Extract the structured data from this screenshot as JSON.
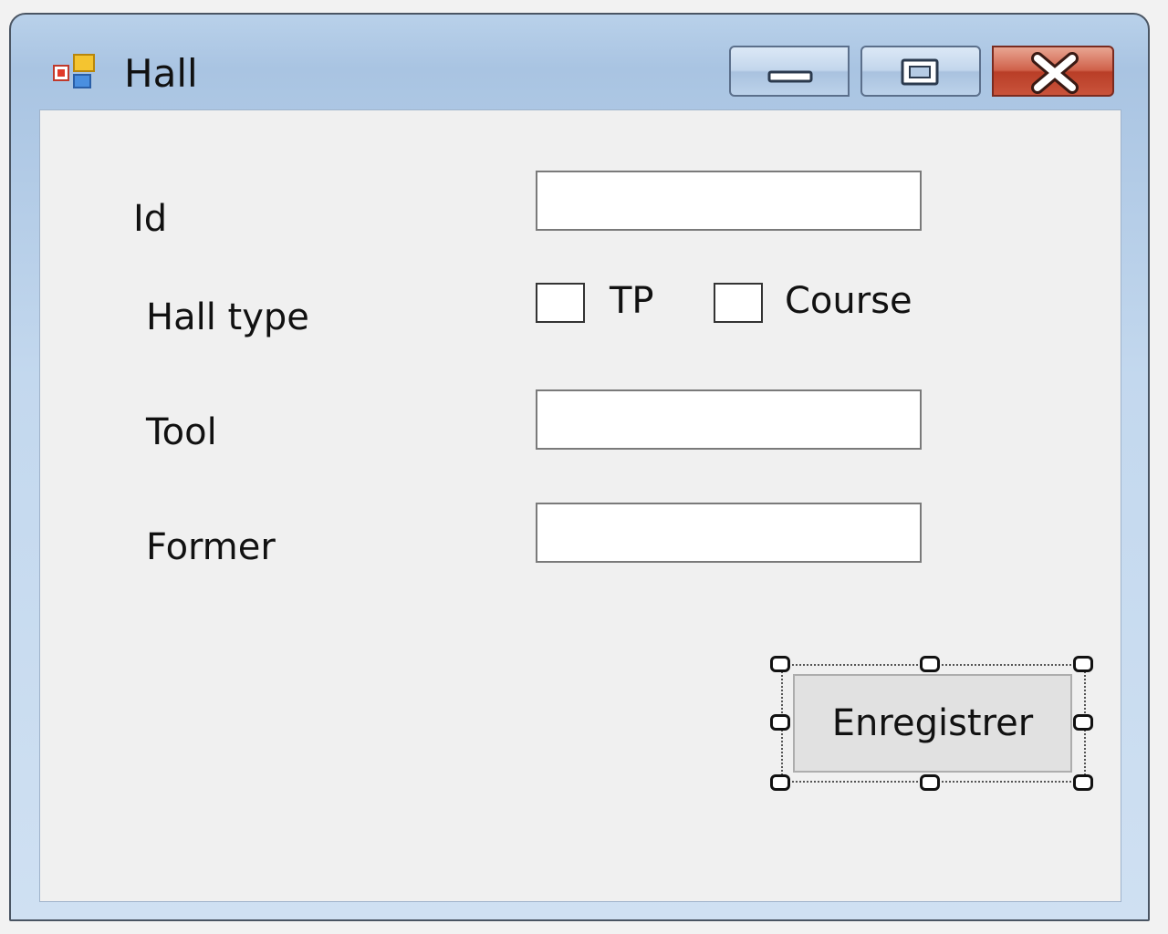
{
  "window": {
    "title": "Hall",
    "icon": "windows-form-icon"
  },
  "title_buttons": {
    "minimize_icon": "minimize-icon",
    "maximize_icon": "restore-icon",
    "close_icon": "close-icon"
  },
  "form": {
    "id_label": "Id",
    "id_value": "",
    "hall_type_label": "Hall type",
    "hall_type_options": [
      {
        "label": "TP",
        "checked": false
      },
      {
        "label": "Course",
        "checked": false
      }
    ],
    "tool_label": "Tool",
    "tool_value": "",
    "former_label": "Former",
    "former_value": "",
    "save_button_label": "Enregistrer"
  },
  "colors": {
    "title_bar": "#b9d1ea",
    "client_background": "#f0f0f0",
    "close_button": "#c9533b",
    "button_face": "#e1e1e1"
  }
}
